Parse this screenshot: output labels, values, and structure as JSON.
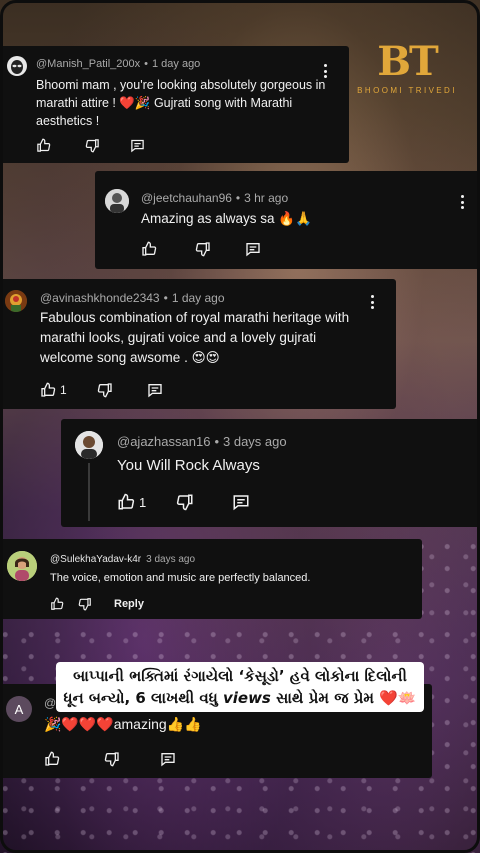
{
  "brand": {
    "logo_mark": "BT",
    "logo_sub": "BHOOMI TRIVEDI",
    "color": "#e1a73a"
  },
  "comments": [
    {
      "author": "@Manish_Patil_200x",
      "time": "1 day ago",
      "text": "Bhoomi mam , you're looking absolutely gorgeous in marathi attire ! ❤️🎉 Gujrati song with Marathi aesthetics !",
      "likes": "",
      "avatar_icon": "alien-avatar-icon"
    },
    {
      "author": "@jeetchauhan96",
      "time": "3 hr ago",
      "text": "Amazing as always sa 🔥🙏",
      "likes": "",
      "avatar_icon": "profile-photo-icon"
    },
    {
      "author": "@avinashkhonde2343",
      "time": "1 day ago",
      "text": "Fabulous combination of royal marathi heritage with marathi looks, gujrati voice and a lovely gujrati welcome song awsome . 😍😍",
      "likes": "1",
      "avatar_icon": "deity-avatar-icon"
    },
    {
      "author": "@ajazhassan16",
      "time": "3 days ago",
      "text": "You Will Rock Always",
      "likes": "1",
      "avatar_icon": "person-avatar-icon"
    },
    {
      "author": "@SulekhaYadav-k4r",
      "time": "3 days ago",
      "text": "The voice, emotion and music are perfectly balanced.",
      "likes": "",
      "reply_label": "Reply",
      "avatar_icon": "woman-avatar-icon"
    },
    {
      "author": "@",
      "time": "",
      "text": "amazing👍👍",
      "emoji_prefix": "🎉❤️❤️❤️",
      "likes": "",
      "avatar_letter": "A",
      "avatar_color": "#5c4a5e"
    }
  ],
  "banner": {
    "line1": "બાપ્પાની ભક્તિમાં રંગાયેલો ‘કેસૂડો’ હવે લોકોના દિલોની",
    "line2_pre": "ધૂન બન્યો, 6 લાખથી વધુ ",
    "line2_views": "views",
    "line2_post": " સાથે પ્રેમ જ પ્રેમ ❤️🪷"
  },
  "colors": {
    "card_bg": "#101010",
    "meta_text": "#aaaaaa",
    "body_text": "#f1f1f1"
  }
}
